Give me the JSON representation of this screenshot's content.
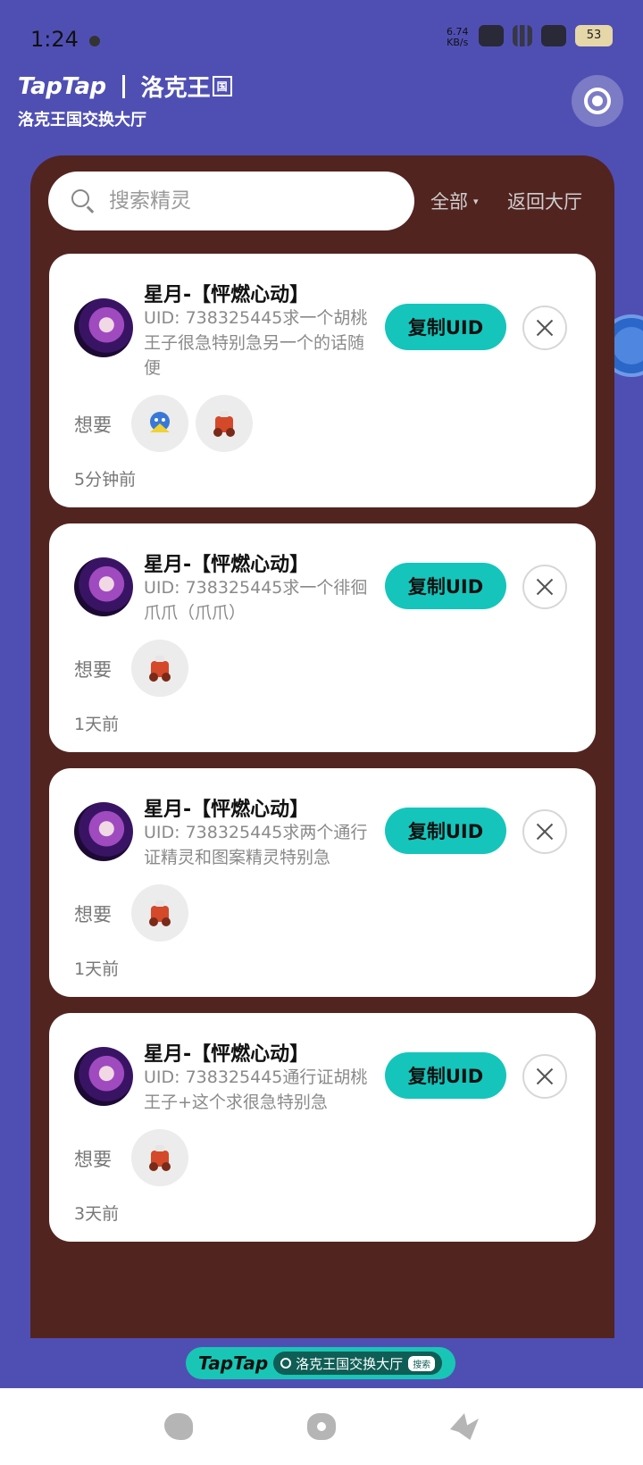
{
  "status_bar": {
    "time": "1:24",
    "speed_value": "6.74",
    "speed_unit": "KB/s",
    "battery": "53"
  },
  "header": {
    "brand_taptap": "TapTap",
    "brand_game": "洛克王",
    "brand_badge": "国",
    "subtitle": "洛克王国交换大厅",
    "target_icon": "target-icon"
  },
  "search": {
    "placeholder": "搜索精灵",
    "value": ""
  },
  "filter": {
    "label": "全部",
    "arrow": "▾",
    "back_label": "返回大厅"
  },
  "cards": [
    {
      "name": "星月-【怦燃心动】",
      "desc": "UID: 738325445求一个胡桃王子很急特别急另一个的话随便",
      "copy_label": "复制UID",
      "want_label": "想要",
      "pets": [
        "blue-yellow-pet",
        "red-robot-pet"
      ],
      "time": "5分钟前"
    },
    {
      "name": "星月-【怦燃心动】",
      "desc": "UID: 738325445求一个徘徊爪爪（爪爪）",
      "copy_label": "复制UID",
      "want_label": "想要",
      "pets": [
        "red-robot-pet"
      ],
      "time": "1天前"
    },
    {
      "name": "星月-【怦燃心动】",
      "desc": "UID: 738325445求两个通行证精灵和图案精灵特别急",
      "copy_label": "复制UID",
      "want_label": "想要",
      "pets": [
        "red-robot-pet"
      ],
      "time": "1天前"
    },
    {
      "name": "星月-【怦燃心动】",
      "desc": "UID: 738325445通行证胡桃王子+这个求很急特别急",
      "copy_label": "复制UID",
      "want_label": "想要",
      "pets": [
        "red-robot-pet"
      ],
      "time": "3天前"
    }
  ],
  "banner": {
    "taptap": "TapTap",
    "text": "洛克王国交换大厅",
    "tag": "搜索"
  },
  "bottom_nav": {
    "icons": [
      "dino-icon",
      "flower-icon",
      "bird-icon"
    ]
  },
  "colors": {
    "background": "#4f4fb3",
    "panel": "#522420",
    "accent": "#15c5bb"
  }
}
